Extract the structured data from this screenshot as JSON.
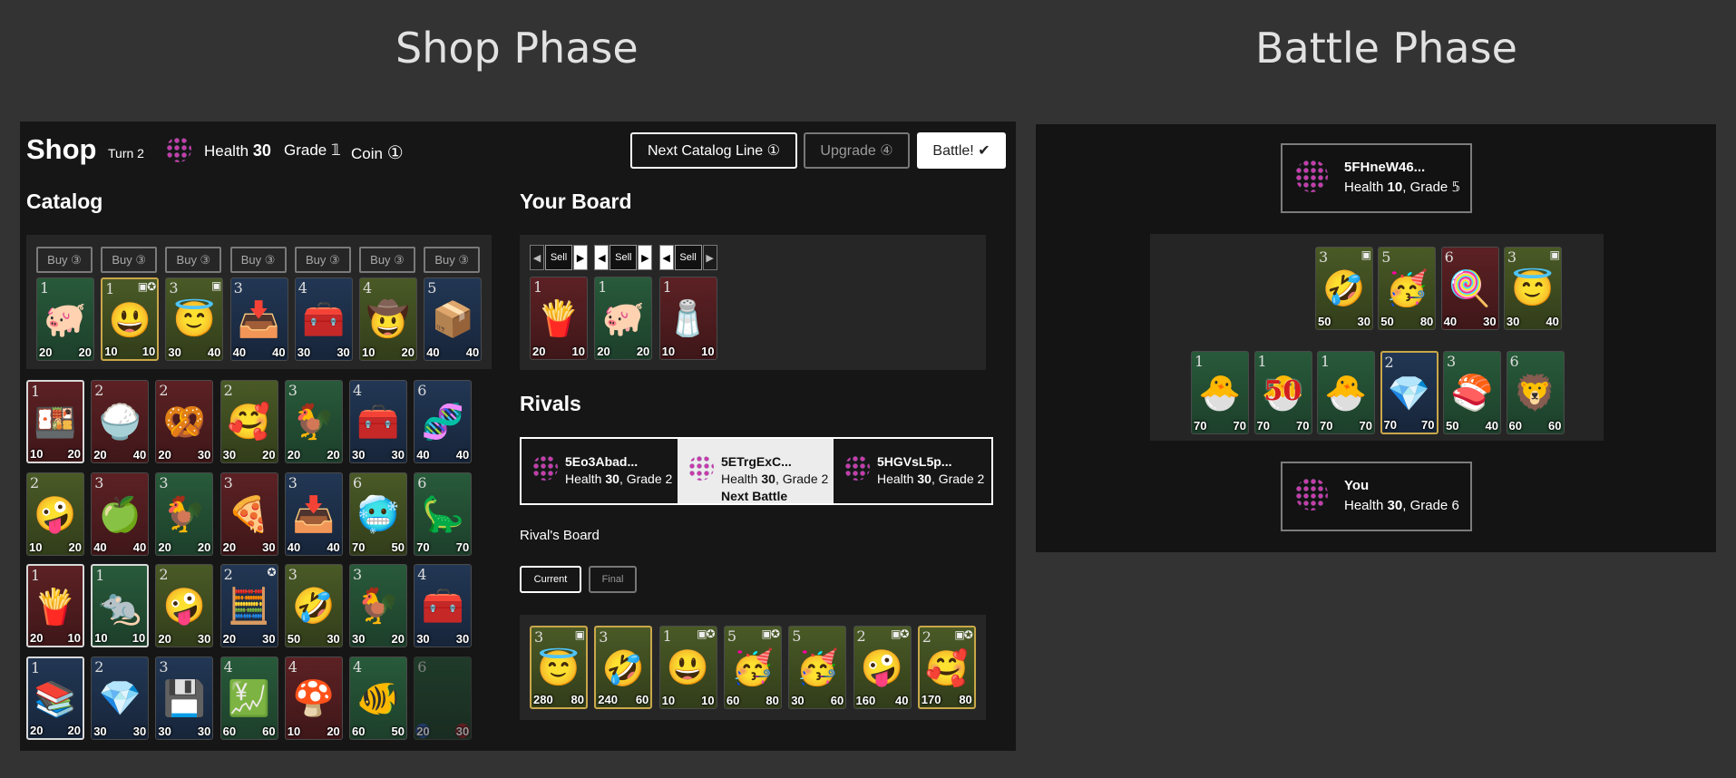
{
  "headings": {
    "shop_phase": "Shop Phase",
    "battle_phase": "Battle Phase"
  },
  "shop": {
    "title": "Shop",
    "turn": "Turn 2",
    "health_label": "Health",
    "health_value": "30",
    "grade_label": "Grade",
    "grade_value": "𝟙",
    "coin_label": "Coin",
    "coin_value": "①",
    "next_catalog_button": "Next Catalog Line ①",
    "upgrade_button": "Upgrade ④",
    "battle_button": "Battle! ✔"
  },
  "catalog": {
    "title": "Catalog",
    "buy_label": "Buy ③",
    "line": [
      {
        "tier": "1",
        "emoji": "🐖",
        "atk": "20",
        "hp": "20",
        "color": "green",
        "badge": "",
        "style": ""
      },
      {
        "tier": "1",
        "emoji": "😃",
        "atk": "10",
        "hp": "10",
        "color": "olive",
        "badge": "▣✪",
        "style": "gold"
      },
      {
        "tier": "3",
        "emoji": "😇",
        "atk": "30",
        "hp": "40",
        "color": "olive",
        "badge": "▣",
        "style": ""
      },
      {
        "tier": "3",
        "emoji": "📥",
        "atk": "40",
        "hp": "40",
        "color": "blue",
        "badge": "",
        "style": ""
      },
      {
        "tier": "4",
        "emoji": "🧰",
        "atk": "30",
        "hp": "30",
        "color": "blue",
        "badge": "",
        "style": ""
      },
      {
        "tier": "4",
        "emoji": "🤠",
        "atk": "10",
        "hp": "20",
        "color": "olive",
        "badge": "",
        "style": ""
      },
      {
        "tier": "5",
        "emoji": "📦",
        "atk": "40",
        "hp": "40",
        "color": "blue",
        "badge": "",
        "style": ""
      }
    ],
    "rows": [
      [
        {
          "tier": "1",
          "emoji": "🍱",
          "atk": "10",
          "hp": "20",
          "color": "red",
          "badge": "",
          "style": "bright"
        },
        {
          "tier": "2",
          "emoji": "🍚",
          "atk": "20",
          "hp": "40",
          "color": "red",
          "badge": "",
          "style": ""
        },
        {
          "tier": "2",
          "emoji": "🥨",
          "atk": "20",
          "hp": "30",
          "color": "red",
          "badge": "",
          "style": ""
        },
        {
          "tier": "2",
          "emoji": "🥰",
          "atk": "30",
          "hp": "20",
          "color": "olive",
          "badge": "",
          "style": ""
        },
        {
          "tier": "3",
          "emoji": "🐓",
          "atk": "20",
          "hp": "20",
          "color": "green",
          "badge": "",
          "style": ""
        },
        {
          "tier": "4",
          "emoji": "🧰",
          "atk": "30",
          "hp": "30",
          "color": "blue",
          "badge": "",
          "style": ""
        },
        {
          "tier": "6",
          "emoji": "🧬",
          "atk": "40",
          "hp": "40",
          "color": "blue",
          "badge": "",
          "style": ""
        }
      ],
      [
        {
          "tier": "2",
          "emoji": "🤪",
          "atk": "10",
          "hp": "20",
          "color": "olive",
          "badge": "",
          "style": ""
        },
        {
          "tier": "3",
          "emoji": "🍏",
          "atk": "40",
          "hp": "40",
          "color": "red",
          "badge": "",
          "style": ""
        },
        {
          "tier": "3",
          "emoji": "🐓",
          "atk": "20",
          "hp": "20",
          "color": "green",
          "badge": "",
          "style": ""
        },
        {
          "tier": "3",
          "emoji": "🍕",
          "atk": "20",
          "hp": "30",
          "color": "red",
          "badge": "",
          "style": ""
        },
        {
          "tier": "3",
          "emoji": "📥",
          "atk": "40",
          "hp": "40",
          "color": "blue",
          "badge": "",
          "style": ""
        },
        {
          "tier": "6",
          "emoji": "🥶",
          "atk": "70",
          "hp": "50",
          "color": "olive",
          "badge": "",
          "style": ""
        },
        {
          "tier": "6",
          "emoji": "🦕",
          "atk": "70",
          "hp": "70",
          "color": "green",
          "badge": "",
          "style": ""
        }
      ],
      [
        {
          "tier": "1",
          "emoji": "🍟",
          "atk": "20",
          "hp": "10",
          "color": "red",
          "badge": "",
          "style": "bright"
        },
        {
          "tier": "1",
          "emoji": "🐀",
          "atk": "10",
          "hp": "10",
          "color": "green",
          "badge": "",
          "style": "bright"
        },
        {
          "tier": "2",
          "emoji": "🤪",
          "atk": "20",
          "hp": "30",
          "color": "olive",
          "badge": "",
          "style": ""
        },
        {
          "tier": "2",
          "emoji": "🧮",
          "atk": "20",
          "hp": "30",
          "color": "blue",
          "badge": "✪",
          "style": ""
        },
        {
          "tier": "3",
          "emoji": "🤣",
          "atk": "50",
          "hp": "30",
          "color": "olive",
          "badge": "",
          "style": ""
        },
        {
          "tier": "3",
          "emoji": "🐓",
          "atk": "30",
          "hp": "20",
          "color": "green",
          "badge": "",
          "style": ""
        },
        {
          "tier": "4",
          "emoji": "🧰",
          "atk": "30",
          "hp": "30",
          "color": "blue",
          "badge": "",
          "style": ""
        }
      ],
      [
        {
          "tier": "1",
          "emoji": "📚",
          "atk": "20",
          "hp": "20",
          "color": "blue",
          "badge": "",
          "style": "bright"
        },
        {
          "tier": "2",
          "emoji": "💎",
          "atk": "30",
          "hp": "30",
          "color": "blue",
          "badge": "",
          "style": ""
        },
        {
          "tier": "3",
          "emoji": "💾",
          "atk": "30",
          "hp": "30",
          "color": "blue",
          "badge": "",
          "style": ""
        },
        {
          "tier": "4",
          "emoji": "💹",
          "atk": "60",
          "hp": "60",
          "color": "green",
          "badge": "",
          "style": ""
        },
        {
          "tier": "4",
          "emoji": "🍄",
          "atk": "10",
          "hp": "20",
          "color": "red",
          "badge": "",
          "style": ""
        },
        {
          "tier": "4",
          "emoji": "🐠",
          "atk": "60",
          "hp": "50",
          "color": "green",
          "badge": "",
          "style": ""
        },
        {
          "tier": "6",
          "emoji": "",
          "atk": "20",
          "hp": "30",
          "color": "green",
          "badge": "",
          "style": "dim"
        }
      ]
    ]
  },
  "board": {
    "title": "Your Board",
    "sell_label": "Sell",
    "cards": [
      {
        "tier": "1",
        "emoji": "🍟",
        "atk": "20",
        "hp": "10",
        "color": "red",
        "badge": "",
        "style": ""
      },
      {
        "tier": "1",
        "emoji": "🐖",
        "atk": "20",
        "hp": "20",
        "color": "green",
        "badge": "",
        "style": ""
      },
      {
        "tier": "1",
        "emoji": "🧂",
        "atk": "10",
        "hp": "10",
        "color": "red",
        "badge": "",
        "style": ""
      }
    ]
  },
  "rivals": {
    "title": "Rivals",
    "list": [
      {
        "name": "5Eo3Abad...",
        "health_label": "Health",
        "health": "30",
        "grade_label": "Grade",
        "grade": "2",
        "note": ""
      },
      {
        "name": "5ETrgExC...",
        "health_label": "Health",
        "health": "30",
        "grade_label": "Grade",
        "grade": "2",
        "note": "Next Battle"
      },
      {
        "name": "5HGVsL5p...",
        "health_label": "Health",
        "health": "30",
        "grade_label": "Grade",
        "grade": "2",
        "note": ""
      }
    ],
    "board_title": "Rival's Board",
    "tab_current": "Current",
    "tab_final": "Final",
    "board_cards": [
      {
        "tier": "3",
        "emoji": "😇",
        "atk": "280",
        "hp": "80",
        "color": "olive",
        "badge": "▣",
        "style": "gold"
      },
      {
        "tier": "3",
        "emoji": "🤣",
        "atk": "240",
        "hp": "60",
        "color": "olive",
        "badge": "",
        "style": "gold"
      },
      {
        "tier": "1",
        "emoji": "😃",
        "atk": "10",
        "hp": "10",
        "color": "olive",
        "badge": "▣✪",
        "style": ""
      },
      {
        "tier": "5",
        "emoji": "🥳",
        "atk": "60",
        "hp": "80",
        "color": "olive",
        "badge": "▣✪",
        "style": ""
      },
      {
        "tier": "5",
        "emoji": "🥳",
        "atk": "30",
        "hp": "60",
        "color": "olive",
        "badge": "",
        "style": ""
      },
      {
        "tier": "2",
        "emoji": "🤪",
        "atk": "160",
        "hp": "40",
        "color": "olive",
        "badge": "▣✪",
        "style": ""
      },
      {
        "tier": "2",
        "emoji": "🥰",
        "atk": "170",
        "hp": "80",
        "color": "olive",
        "badge": "▣✪",
        "style": "gold"
      }
    ]
  },
  "battle": {
    "opponent": {
      "name": "5FHneW46...",
      "health_label": "Health",
      "health": "10",
      "grade_label": "Grade",
      "grade": "𝟝"
    },
    "opponent_cards": [
      {
        "tier": "3",
        "emoji": "🤣",
        "atk": "50",
        "hp": "30",
        "color": "olive",
        "badge": "▣",
        "style": ""
      },
      {
        "tier": "5",
        "emoji": "🥳",
        "atk": "50",
        "hp": "80",
        "color": "olive",
        "badge": "",
        "style": ""
      },
      {
        "tier": "6",
        "emoji": "🍭",
        "atk": "40",
        "hp": "30",
        "color": "red",
        "badge": "",
        "style": ""
      },
      {
        "tier": "3",
        "emoji": "😇",
        "atk": "30",
        "hp": "40",
        "color": "olive",
        "badge": "▣",
        "style": ""
      }
    ],
    "player_cards": [
      {
        "tier": "1",
        "emoji": "🐣",
        "atk": "70",
        "hp": "70",
        "color": "green",
        "badge": "",
        "style": ""
      },
      {
        "tier": "1",
        "emoji": "🐣",
        "atk": "70",
        "hp": "70",
        "color": "green",
        "badge": "",
        "style": ""
      },
      {
        "tier": "1",
        "emoji": "🐣",
        "atk": "70",
        "hp": "70",
        "color": "green",
        "badge": "",
        "style": ""
      },
      {
        "tier": "2",
        "emoji": "💎",
        "atk": "70",
        "hp": "70",
        "color": "blue",
        "badge": "",
        "style": "gold"
      },
      {
        "tier": "3",
        "emoji": "🍣",
        "atk": "50",
        "hp": "40",
        "color": "green",
        "badge": "",
        "style": ""
      },
      {
        "tier": "6",
        "emoji": "🦁",
        "atk": "60",
        "hp": "60",
        "color": "green",
        "badge": "",
        "style": ""
      }
    ],
    "player_overlay": "50",
    "player": {
      "name": "You",
      "health_label": "Health",
      "health": "30",
      "grade_label": "Grade",
      "grade": "6"
    }
  }
}
